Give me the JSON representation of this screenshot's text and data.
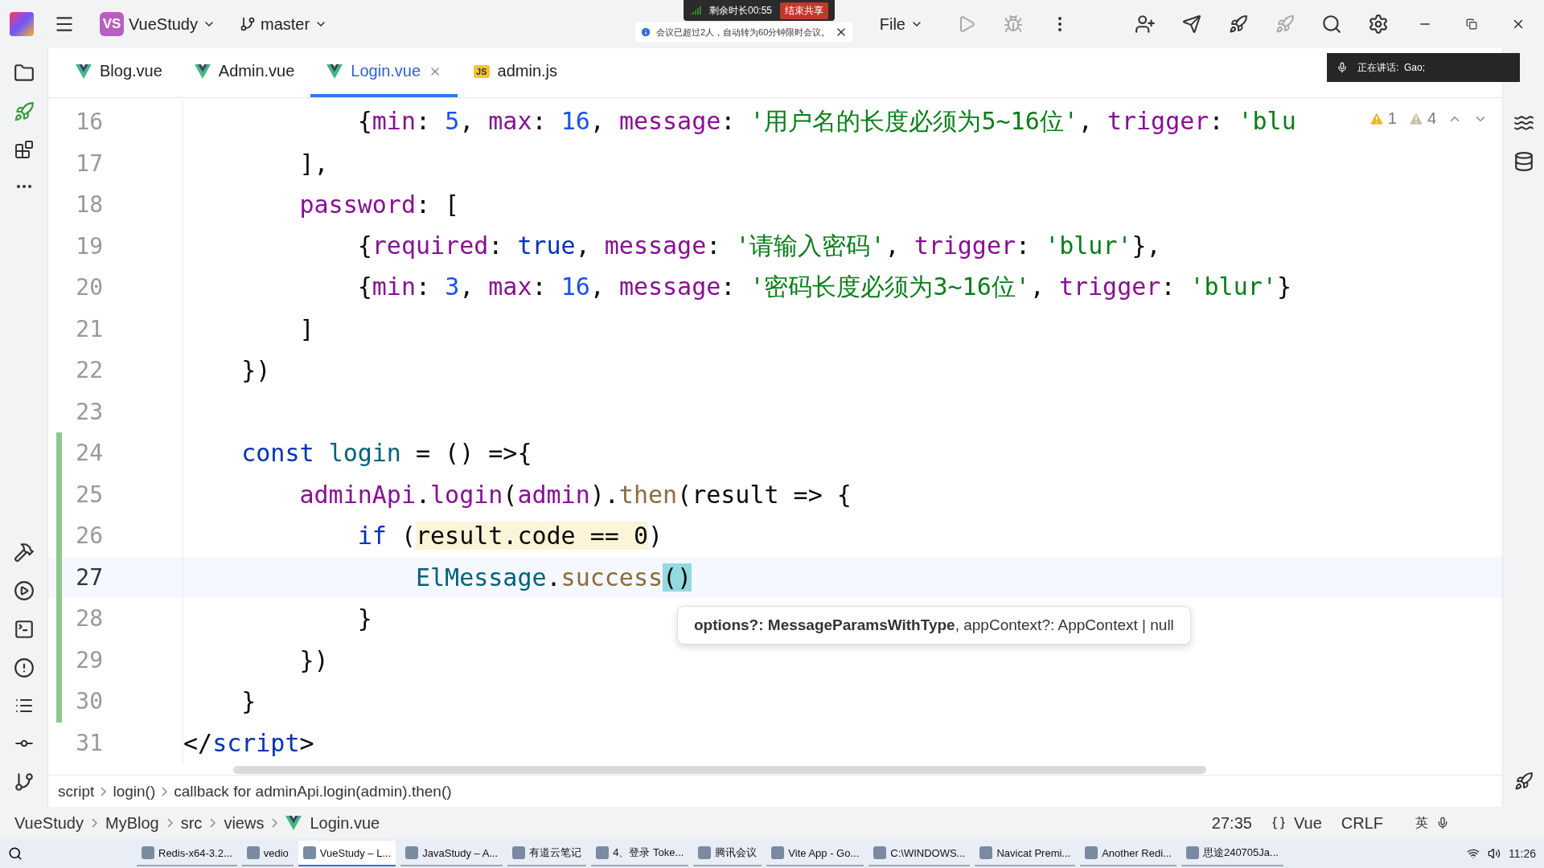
{
  "meeting": {
    "timer": "剩余时长00:55",
    "stop_button": "结束共享",
    "notice": "会议已超过2人，自动转为60分钟限时会议。",
    "speaking": "正在讲话:  Gao;"
  },
  "top_bar": {
    "project_badge": "VS",
    "project": "VueStudy",
    "branch": "master",
    "menu": "File"
  },
  "tabs": [
    {
      "label": "Blog.vue",
      "kind": "vue",
      "selected": false
    },
    {
      "label": "Admin.vue",
      "kind": "vue",
      "selected": false
    },
    {
      "label": "Login.vue",
      "kind": "vue",
      "selected": true
    },
    {
      "label": "admin.js",
      "kind": "js",
      "icon_text": "JS",
      "selected": false
    }
  ],
  "inspections": {
    "warnings": "1",
    "weak_warnings": "4"
  },
  "code_lines": [
    {
      "number": "16",
      "changed": false,
      "current": false,
      "tokens": [
        {
          "t": "            {",
          "kind": "p"
        },
        {
          "t": "min",
          "kind": "prop"
        },
        {
          "t": ": ",
          "kind": "p"
        },
        {
          "t": "5",
          "kind": "num"
        },
        {
          "t": ", ",
          "kind": "p"
        },
        {
          "t": "max",
          "kind": "prop"
        },
        {
          "t": ": ",
          "kind": "p"
        },
        {
          "t": "16",
          "kind": "num"
        },
        {
          "t": ", ",
          "kind": "p"
        },
        {
          "t": "message",
          "kind": "prop"
        },
        {
          "t": ": ",
          "kind": "p"
        },
        {
          "t": "'用户名的长度必须为5~16位'",
          "kind": "str"
        },
        {
          "t": ", ",
          "kind": "p"
        },
        {
          "t": "trigger",
          "kind": "prop"
        },
        {
          "t": ": ",
          "kind": "p"
        },
        {
          "t": "'blu",
          "kind": "str"
        }
      ]
    },
    {
      "number": "17",
      "changed": false,
      "current": false,
      "tokens": [
        {
          "t": "        ],",
          "kind": "p"
        }
      ]
    },
    {
      "number": "18",
      "changed": false,
      "current": false,
      "tokens": [
        {
          "t": "        password",
          "kind": "prop"
        },
        {
          "t": ": [",
          "kind": "p"
        }
      ]
    },
    {
      "number": "19",
      "changed": false,
      "current": false,
      "tokens": [
        {
          "t": "            {",
          "kind": "p"
        },
        {
          "t": "required",
          "kind": "prop"
        },
        {
          "t": ": ",
          "kind": "p"
        },
        {
          "t": "true",
          "kind": "kw"
        },
        {
          "t": ", ",
          "kind": "p"
        },
        {
          "t": "message",
          "kind": "prop"
        },
        {
          "t": ": ",
          "kind": "p"
        },
        {
          "t": "'请输入密码'",
          "kind": "str"
        },
        {
          "t": ", ",
          "kind": "p"
        },
        {
          "t": "trigger",
          "kind": "prop"
        },
        {
          "t": ": ",
          "kind": "p"
        },
        {
          "t": "'blur'",
          "kind": "str"
        },
        {
          "t": "},",
          "kind": "p"
        }
      ]
    },
    {
      "number": "20",
      "changed": false,
      "current": false,
      "tokens": [
        {
          "t": "            {",
          "kind": "p"
        },
        {
          "t": "min",
          "kind": "prop"
        },
        {
          "t": ": ",
          "kind": "p"
        },
        {
          "t": "3",
          "kind": "num"
        },
        {
          "t": ", ",
          "kind": "p"
        },
        {
          "t": "max",
          "kind": "prop"
        },
        {
          "t": ": ",
          "kind": "p"
        },
        {
          "t": "16",
          "kind": "num"
        },
        {
          "t": ", ",
          "kind": "p"
        },
        {
          "t": "message",
          "kind": "prop"
        },
        {
          "t": ": ",
          "kind": "p"
        },
        {
          "t": "'密码长度必须为3~16位'",
          "kind": "str"
        },
        {
          "t": ", ",
          "kind": "p"
        },
        {
          "t": "trigger",
          "kind": "prop"
        },
        {
          "t": ": ",
          "kind": "p"
        },
        {
          "t": "'blur'",
          "kind": "str"
        },
        {
          "t": "}",
          "kind": "p"
        }
      ]
    },
    {
      "number": "21",
      "changed": false,
      "current": false,
      "tokens": [
        {
          "t": "        ]",
          "kind": "p"
        }
      ]
    },
    {
      "number": "22",
      "changed": false,
      "current": false,
      "tokens": [
        {
          "t": "    })",
          "kind": "p"
        }
      ]
    },
    {
      "number": "23",
      "changed": false,
      "current": false
    },
    {
      "number": "24",
      "changed": true,
      "current": false,
      "tokens": [
        {
          "t": "    const ",
          "kind": "kw"
        },
        {
          "t": "login",
          "kind": "fn"
        },
        {
          "t": " = () =>{",
          "kind": "p"
        }
      ]
    },
    {
      "number": "25",
      "changed": true,
      "current": false,
      "tokens": [
        {
          "t": "        adminApi",
          "kind": "prop"
        },
        {
          "t": ".",
          "kind": "p"
        },
        {
          "t": "login",
          "kind": "prop"
        },
        {
          "t": "(",
          "kind": "p"
        },
        {
          "t": "admin",
          "kind": "prop"
        },
        {
          "t": ").",
          "kind": "p"
        },
        {
          "t": "then",
          "kind": "call"
        },
        {
          "t": "(result => {",
          "kind": "p"
        }
      ]
    },
    {
      "number": "26",
      "changed": true,
      "current": false,
      "tokens": [
        {
          "t": "            if ",
          "kind": "kw"
        },
        {
          "t": "(",
          "kind": "p"
        },
        {
          "t": "result.code == 0",
          "kind": "match"
        },
        {
          "t": ")",
          "kind": "p"
        }
      ]
    },
    {
      "number": "27",
      "changed": true,
      "current": true,
      "tokens": [
        {
          "t": "                ElMessage",
          "kind": "cls"
        },
        {
          "t": ".",
          "kind": "p"
        },
        {
          "t": "success",
          "kind": "call"
        },
        {
          "t": "()",
          "kind": "paren"
        }
      ]
    },
    {
      "number": "28",
      "changed": true,
      "current": false,
      "tokens": [
        {
          "t": "            }",
          "kind": "p"
        }
      ]
    },
    {
      "number": "29",
      "changed": true,
      "current": false,
      "tokens": [
        {
          "t": "        })",
          "kind": "p"
        }
      ]
    },
    {
      "number": "30",
      "changed": true,
      "current": false,
      "tokens": [
        {
          "t": "    }",
          "kind": "p"
        }
      ]
    },
    {
      "number": "31",
      "changed": false,
      "current": false,
      "tokens": [
        {
          "t": "</",
          "kind": "p"
        },
        {
          "t": "script",
          "kind": "tag"
        },
        {
          "t": ">",
          "kind": "p"
        }
      ]
    }
  ],
  "parameter_hint": "**options?: MessageParamsWithType**, appContext?: AppContext | null",
  "breadcrumb": [
    "script",
    "login()",
    "callback for adminApi.login(admin).then()"
  ],
  "status_bar": {
    "path": [
      "VueStudy",
      "MyBlog",
      "src",
      "views",
      "Login.vue"
    ],
    "position": "27:35",
    "language": "Vue",
    "line_ending": "CRLF",
    "ime": "英"
  },
  "taskbar": {
    "apps": [
      {
        "label": "Redis-x64-3.2...",
        "selected": false
      },
      {
        "label": "vedio",
        "selected": false
      },
      {
        "label": "VueStudy – L...",
        "selected": true
      },
      {
        "label": "JavaStudy – A...",
        "selected": false
      },
      {
        "label": "有道云笔记",
        "selected": false
      },
      {
        "label": "4、登录 Toke...",
        "selected": false
      },
      {
        "label": "腾讯会议",
        "selected": false
      },
      {
        "label": "Vite App - Go...",
        "selected": false
      },
      {
        "label": "C:\\WINDOWS...",
        "selected": false
      },
      {
        "label": "Navicat Premi...",
        "selected": false
      },
      {
        "label": "Another Redi...",
        "selected": false
      },
      {
        "label": "思途240705Ja...",
        "selected": false
      }
    ],
    "time": "11:26"
  }
}
